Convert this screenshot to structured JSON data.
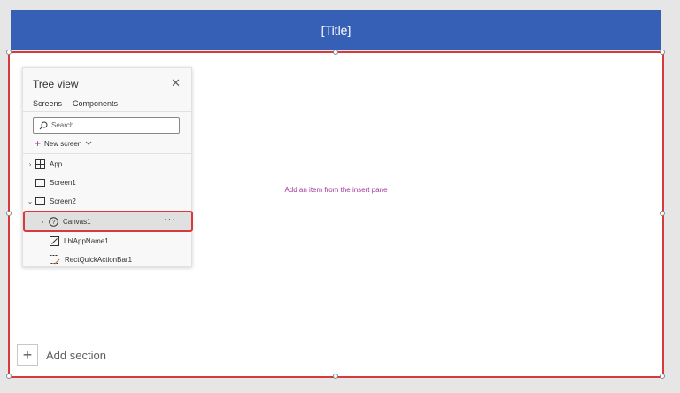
{
  "header": {
    "title": "[Title]"
  },
  "canvas": {
    "placeholder": "Add an item from the insert pane",
    "add_section_label": "Add section"
  },
  "tree_view": {
    "title": "Tree view",
    "tabs": [
      {
        "label": "Screens",
        "active": true
      },
      {
        "label": "Components",
        "active": false
      }
    ],
    "search_placeholder": "Search",
    "new_screen_label": "New screen",
    "items": [
      {
        "label": "App",
        "icon": "app-icon"
      },
      {
        "label": "Screen1",
        "icon": "screen-icon"
      },
      {
        "label": "Screen2",
        "icon": "screen-icon"
      },
      {
        "label": "Canvas1",
        "icon": "help-circle-icon",
        "selected": true,
        "more": "···"
      },
      {
        "label": "LblAppName1",
        "icon": "label-edit-icon"
      },
      {
        "label": "RectQuickActionBar1",
        "icon": "rectangle-icon"
      }
    ]
  },
  "colors": {
    "title_bar": "#3560b5",
    "selection_border": "#d63a3a",
    "accent": "#a4379a"
  }
}
